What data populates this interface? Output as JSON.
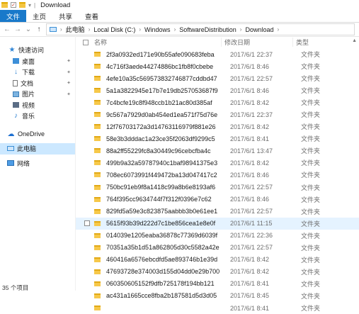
{
  "window": {
    "title": "Download"
  },
  "ribbon": {
    "tabs": [
      "文件",
      "主页",
      "共享",
      "查看"
    ]
  },
  "address": {
    "path": [
      "此电脑",
      "Local Disk (C:)",
      "Windows",
      "SoftwareDistribution",
      "Download"
    ]
  },
  "sidebar": {
    "quick_access": "快速访问",
    "items": [
      {
        "label": "桌面",
        "icon": "folder-blue-icon"
      },
      {
        "label": "下载",
        "icon": "download-icon"
      },
      {
        "label": "文档",
        "icon": "document-icon"
      },
      {
        "label": "图片",
        "icon": "picture-icon"
      },
      {
        "label": "视频",
        "icon": "video-icon"
      },
      {
        "label": "音乐",
        "icon": "music-icon"
      }
    ],
    "onedrive": "OneDrive",
    "this_pc": "此电脑",
    "network": "网络"
  },
  "status": {
    "count": "35 个项目"
  },
  "columns": {
    "name": "名称",
    "date": "修改日期",
    "type": "类型"
  },
  "files": [
    {
      "name": "2f3a0932ed171e90b55afe090683feba",
      "date": "2017/6/1 22:37",
      "type": "文件夹"
    },
    {
      "name": "4c716f3aede44274886bc1fb8f0cbebe",
      "date": "2017/6/1 8:46",
      "type": "文件夹"
    },
    {
      "name": "4efe10a35c569573832746877cddbd47",
      "date": "2017/6/1 22:57",
      "type": "文件夹"
    },
    {
      "name": "5a1a3822945e17b7e19db257053687f9",
      "date": "2017/6/1 8:46",
      "type": "文件夹"
    },
    {
      "name": "7c4bcfe19c8f948ccb1b21ac80d385af",
      "date": "2017/6/1 8:42",
      "type": "文件夹"
    },
    {
      "name": "9c567a7929d0ab454ed1ea571f75d76e",
      "date": "2017/6/1 22:37",
      "type": "文件夹"
    },
    {
      "name": "12f76703172a3d14763116979f881e26",
      "date": "2017/6/1 8:42",
      "type": "文件夹"
    },
    {
      "name": "58e3b3dddac1a23ce35f2063df9299c5",
      "date": "2017/6/1 8:41",
      "type": "文件夹"
    },
    {
      "name": "88a2ff55229fc8a30449c96cebcfba4c",
      "date": "2017/6/1 13:47",
      "type": "文件夹"
    },
    {
      "name": "499b9a32a59787940c1baf98941375e3",
      "date": "2017/6/1 8:42",
      "type": "文件夹"
    },
    {
      "name": "708ec6073991f449472ba13d047417c2",
      "date": "2017/6/1 8:46",
      "type": "文件夹"
    },
    {
      "name": "750bc91eb9f8a1418c99a8b6e8193af6",
      "date": "2017/6/1 22:57",
      "type": "文件夹"
    },
    {
      "name": "764f395cc9634744f7f312f0396e7c62",
      "date": "2017/6/1 8:46",
      "type": "文件夹"
    },
    {
      "name": "829fd5a59e3c823875aabbb3b0e61ee1",
      "date": "2017/6/1 22:57",
      "type": "文件夹"
    },
    {
      "name": "5615f93b39d222d7c1be856cea1e8e0f",
      "date": "2017/6/1 11:15",
      "type": "文件夹"
    },
    {
      "name": "014039e1205eaba36878c77369d6039f",
      "date": "2017/6/1 22:36",
      "type": "文件夹"
    },
    {
      "name": "70351a35b1d51a862805d30c5582a42e",
      "date": "2017/6/1 22:57",
      "type": "文件夹"
    },
    {
      "name": "460416a6576ebcdfd5ae893746b1e39d",
      "date": "2017/6/1 8:42",
      "type": "文件夹"
    },
    {
      "name": "47693728e374003d155d04dd0e29b700",
      "date": "2017/6/1 8:42",
      "type": "文件夹"
    },
    {
      "name": "060350605152f9dfb725178f194bb121",
      "date": "2017/6/1 8:41",
      "type": "文件夹"
    },
    {
      "name": "ac431a1665cce8fba2b187581d5d3d05",
      "date": "2017/6/1 8:45",
      "type": "文件夹"
    },
    {
      "name": "",
      "date": "2017/6/1 8:41",
      "type": "文件夹"
    }
  ],
  "highlighted_row": 14
}
